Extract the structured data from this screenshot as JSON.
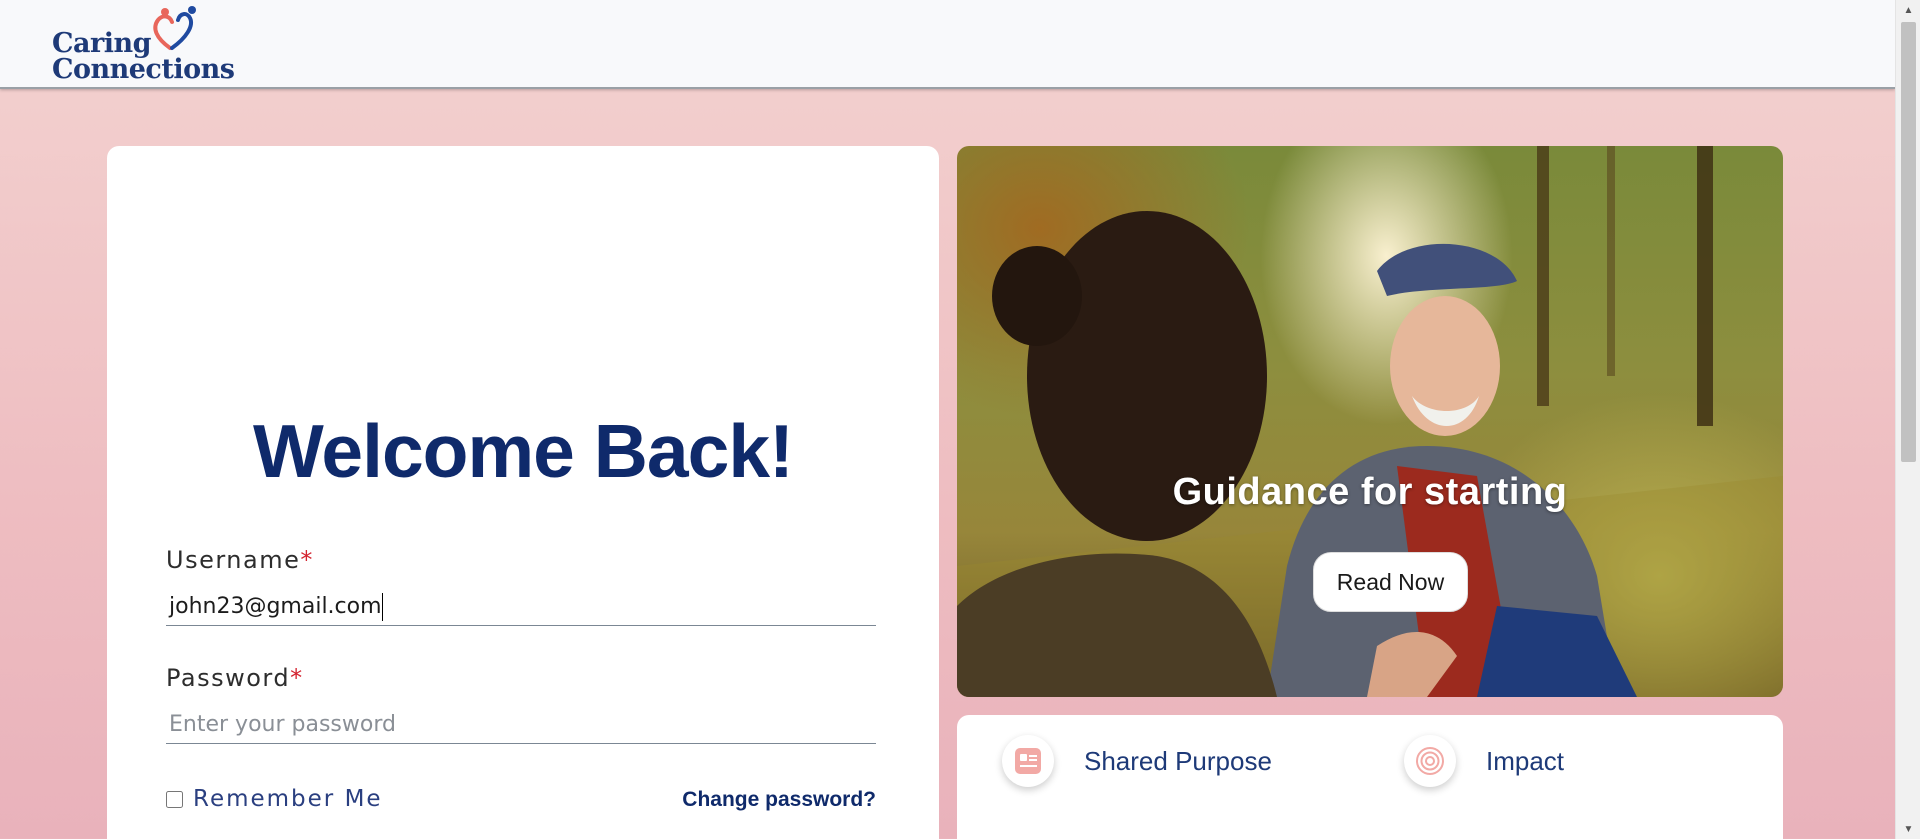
{
  "header": {
    "logo": {
      "line1": "Caring",
      "line2": "Connections"
    }
  },
  "login": {
    "title": "Welcome Back!",
    "username_label": "Username",
    "username_value": "john23@gmail.com",
    "password_label": "Password",
    "password_placeholder": "Enter your password",
    "required_marker": "*",
    "remember_label": "Remember Me",
    "change_password_label": "Change password?"
  },
  "hero": {
    "title": "Guidance for starting",
    "button_label": "Read Now"
  },
  "features": [
    {
      "label": "Shared Purpose",
      "icon": "id-card-icon"
    },
    {
      "label": "Impact",
      "icon": "target-icon"
    }
  ],
  "colors": {
    "brand_navy": "#0f2a6b",
    "required_red": "#d3232f",
    "accent_coral": "#e8665b"
  }
}
